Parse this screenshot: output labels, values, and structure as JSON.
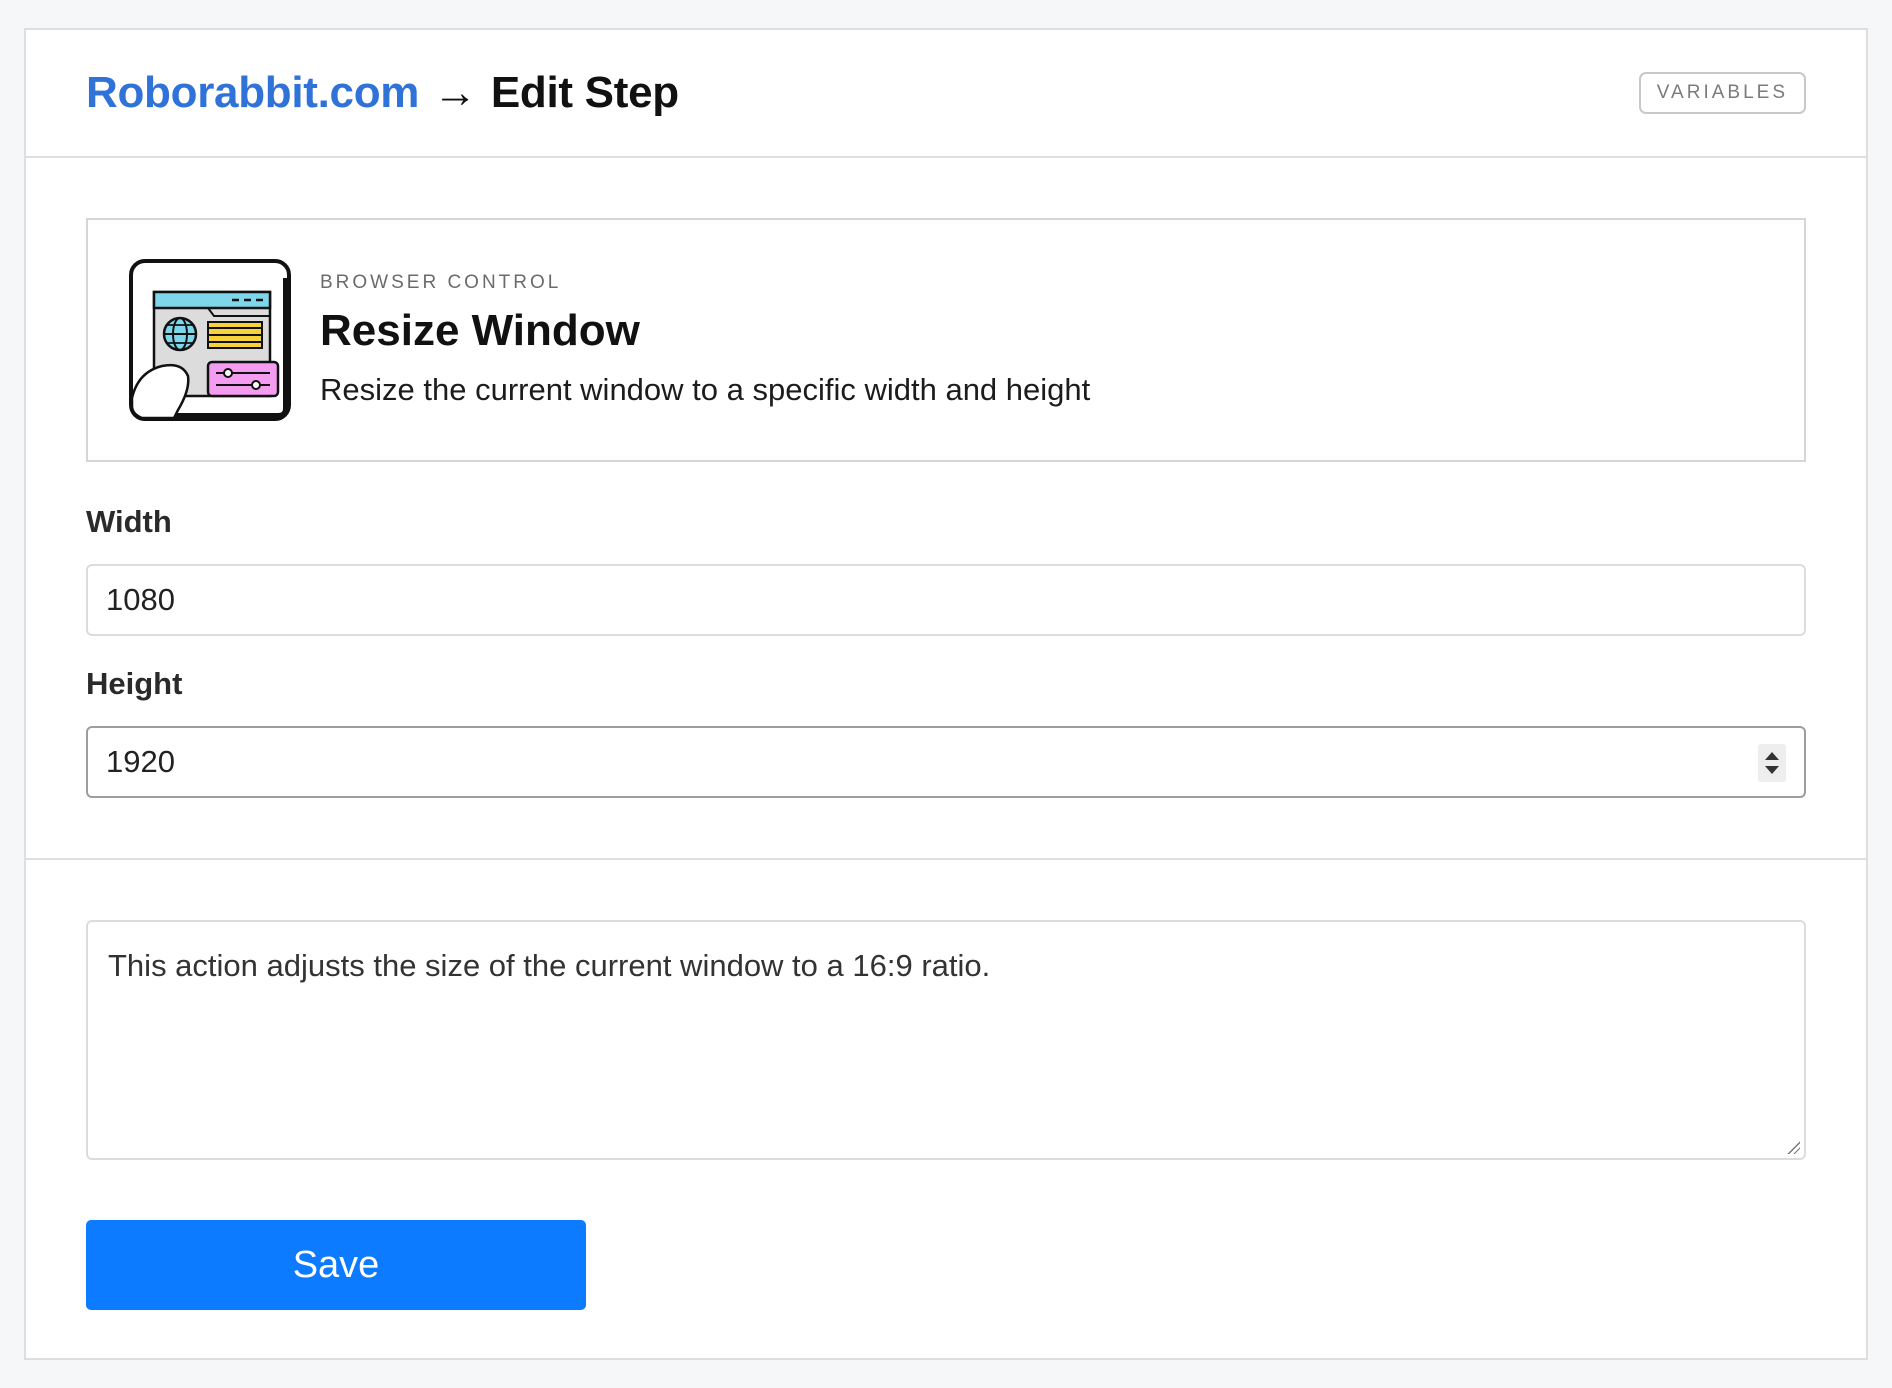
{
  "header": {
    "site_link": "Roborabbit.com",
    "arrow": "→",
    "page_title": "Edit Step",
    "variables_button": "VARIABLES"
  },
  "action": {
    "category": "BROWSER CONTROL",
    "name": "Resize Window",
    "description": "Resize the current window to a specific width and height",
    "icon": "browser-window-icon"
  },
  "fields": {
    "width_label": "Width",
    "width_value": "1080",
    "height_label": "Height",
    "height_value": "1920"
  },
  "notes": {
    "text": "This action adjusts the size of the current window to a 16:9 ratio."
  },
  "save_button": "Save",
  "colors": {
    "link": "#2f72d8",
    "primary": "#0d7bff",
    "icon_cyan": "#7dd6ea",
    "icon_yellow": "#f7d23a",
    "icon_pink": "#f49cf0"
  }
}
